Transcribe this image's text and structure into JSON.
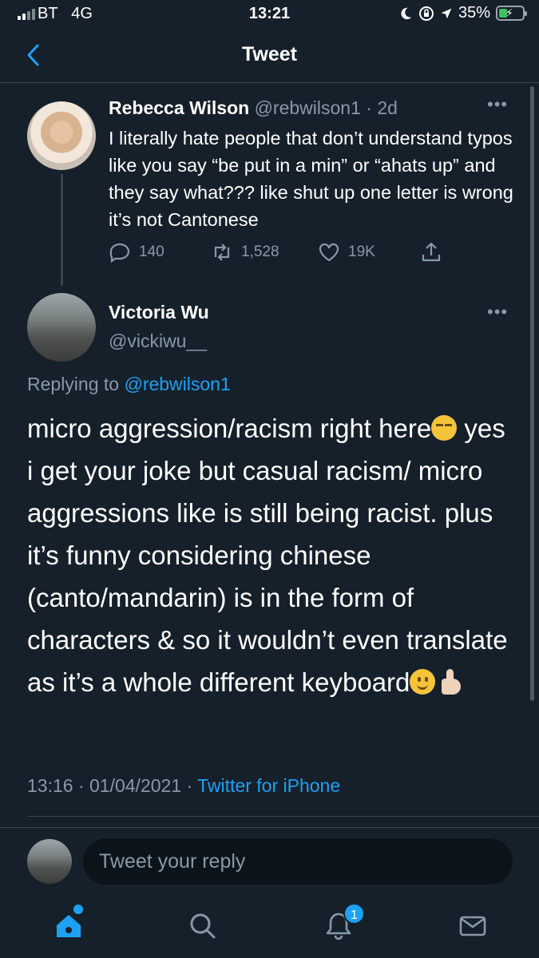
{
  "status": {
    "carrier": "BT",
    "network": "4G",
    "time": "13:21",
    "battery": "35%",
    "battery_level": 0.35,
    "battery_color": "#3ec15f"
  },
  "header": {
    "title": "Tweet",
    "back_icon": "chevron-left-icon"
  },
  "original_tweet": {
    "name": "Rebecca Wilson",
    "handle": "@rebwilson1",
    "age": "· 2d",
    "more": "•••",
    "text": "I literally hate people that don’t understand typos like you say “be put in a min” or “ahats up” and they say what??? like shut up one letter is wrong it’s not Cantonese",
    "replies": "140",
    "retweets": "1,528",
    "likes": "19K"
  },
  "reply_tweet": {
    "name": "Victoria Wu",
    "handle": "@vickiwu__",
    "more": "•••",
    "replying_prefix": "Replying to",
    "replying_to": "@rebwilson1",
    "text_part1": "micro aggression/racism right here",
    "text_part2": "yes i get your joke but casual racism/ micro aggressions like is still being racist. plus it’s funny considering chinese (canto/mandarin) is in the form of characters & so it wouldn’t even translate as it’s a whole different keyboard",
    "timestamp": "13:16 · 01/04/2021 ·",
    "source": "Twitter for iPhone"
  },
  "reply_box": {
    "placeholder": "Tweet your reply"
  },
  "tabbar": {
    "notifications_badge": "1",
    "accent": "#1da1f2"
  }
}
